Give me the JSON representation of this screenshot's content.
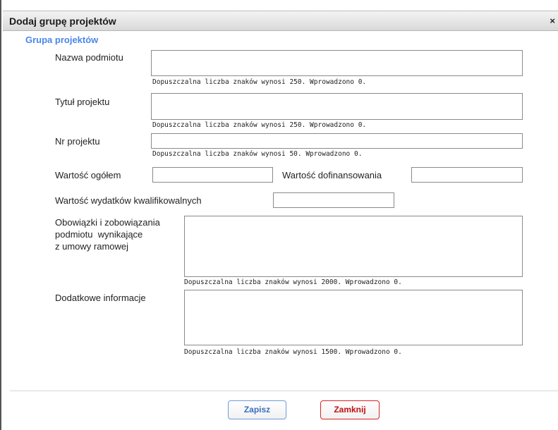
{
  "dialog": {
    "title": "Dodaj grupę projektów",
    "close_label": "×",
    "section_title": "Grupa projektów"
  },
  "form": {
    "nazwa_podmiotu": {
      "label": "Nazwa podmiotu",
      "value": "",
      "hint": "Dopuszczalna liczba znaków wynosi 250. Wprowadzono 0."
    },
    "tytul_projektu": {
      "label": "Tytuł projektu",
      "value": "",
      "hint": "Dopuszczalna liczba znaków wynosi 250. Wprowadzono 0."
    },
    "nr_projektu": {
      "label": "Nr projektu",
      "value": "",
      "hint": "Dopuszczalna liczba znaków wynosi 50. Wprowadzono 0."
    },
    "wartosc_ogolem": {
      "label": "Wartość ogółem",
      "value": ""
    },
    "wartosc_dofinansowania": {
      "label": "Wartość dofinansowania",
      "value": ""
    },
    "wartosc_wydatkow": {
      "label": "Wartość wydatków kwalifikowalnych",
      "value": ""
    },
    "obowiazki": {
      "label_line1": "Obowiązki i zobowiązania",
      "label_line2": "podmiotu  wynikające",
      "label_line3": "z umowy ramowej",
      "value": "",
      "hint": "Dopuszczalna liczba znaków wynosi 2000. Wprowadzono 0."
    },
    "dodatkowe": {
      "label": "Dodatkowe informacje",
      "value": "",
      "hint": "Dopuszczalna liczba znaków wynosi 1500. Wprowadzono 0."
    }
  },
  "buttons": {
    "save_label": "Zapisz",
    "close_label": "Zamknij"
  },
  "colors": {
    "section_title": "#4a86e8",
    "save_button": "#3a6fc4",
    "close_button": "#c01010"
  }
}
